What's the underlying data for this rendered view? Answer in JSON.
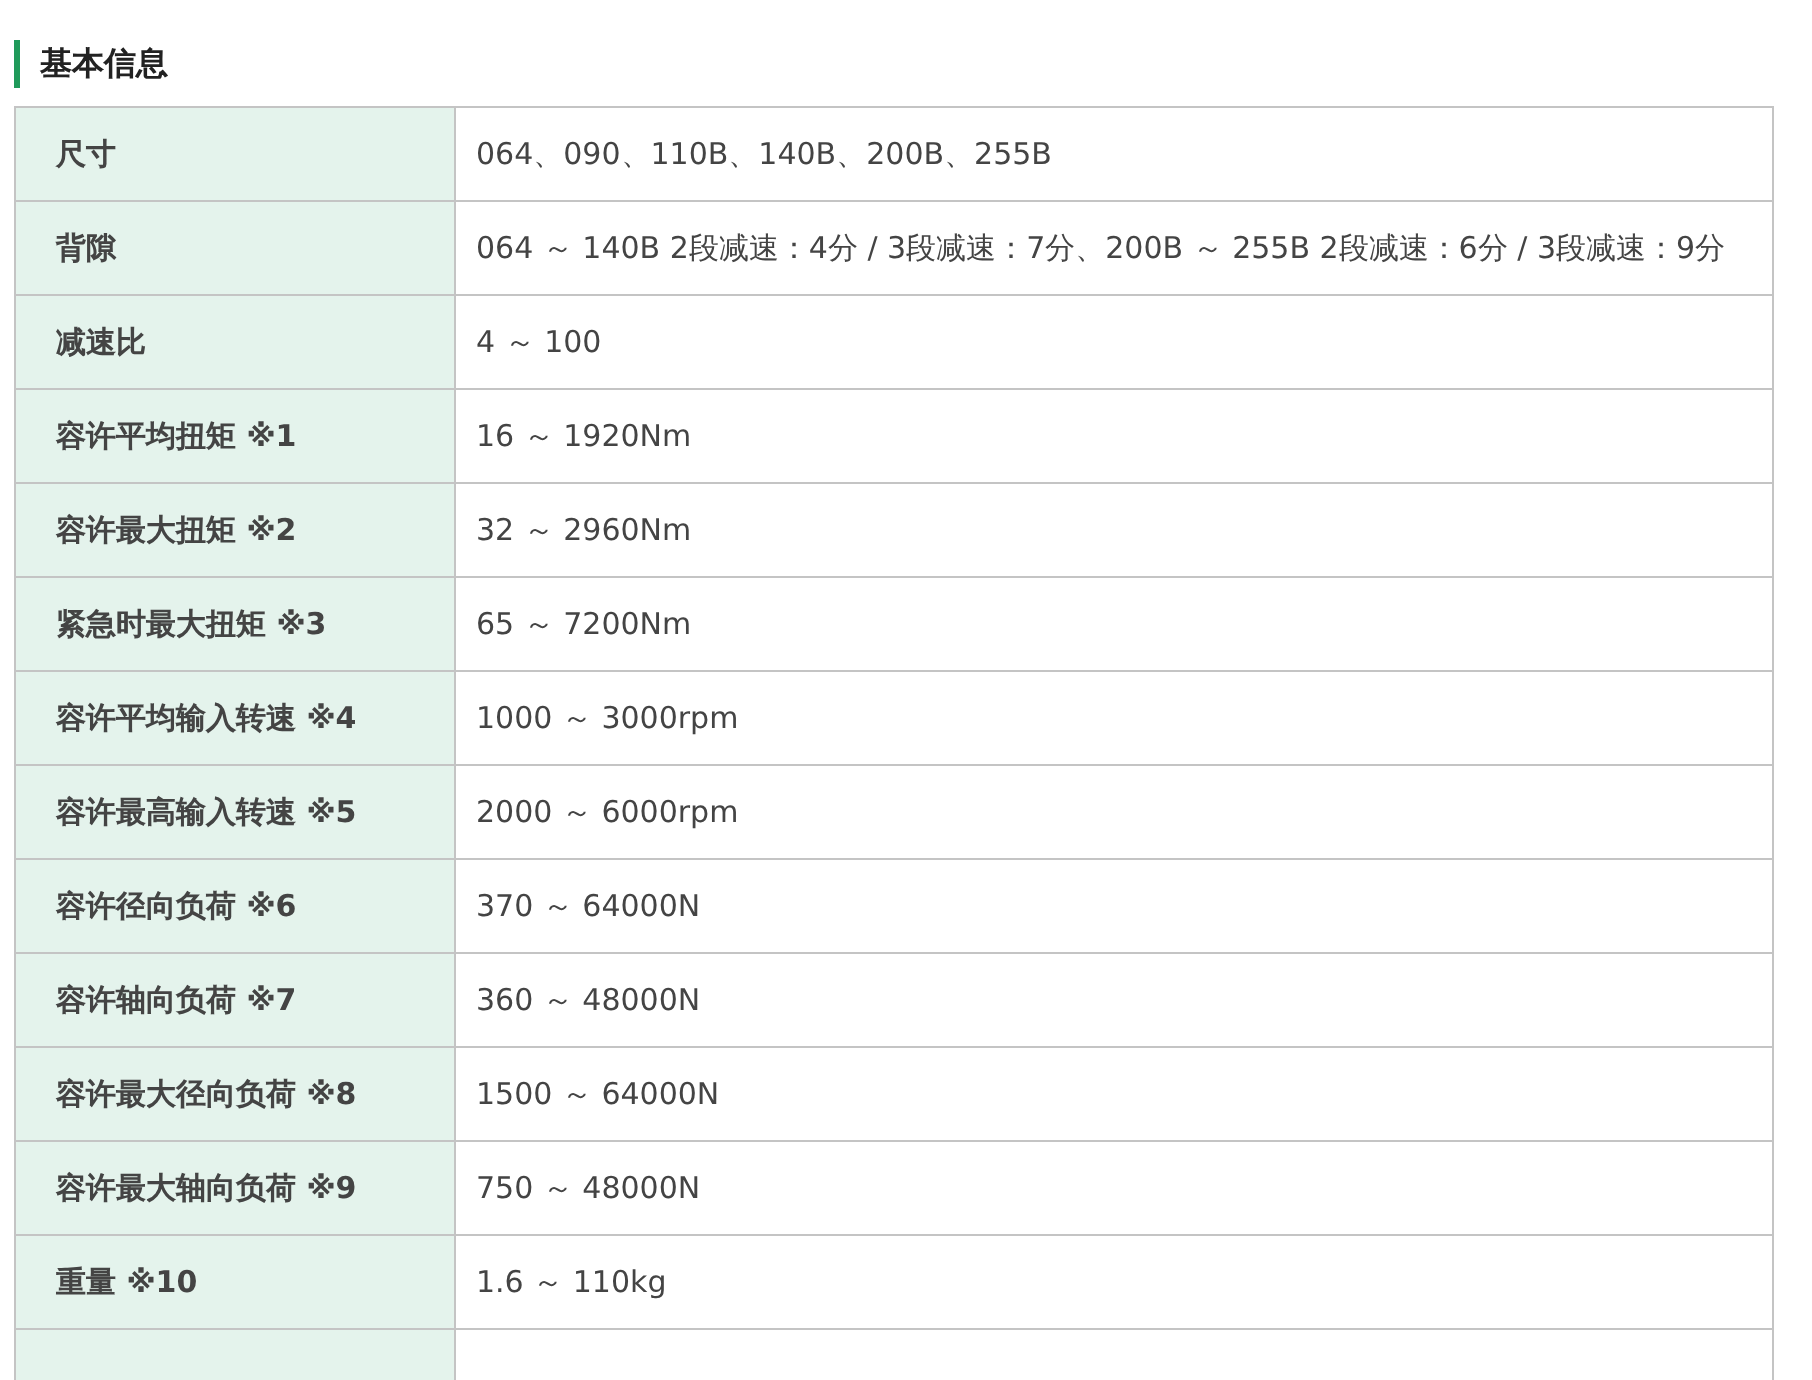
{
  "section": {
    "title": "基本信息"
  },
  "spec_table": {
    "rows": [
      {
        "label": "尺寸",
        "value": "064、090、110B、140B、200B、255B"
      },
      {
        "label": "背隙",
        "value": "064 ～ 140B 2段减速：4分 / 3段减速：7分、200B ～ 255B 2段减速：6分 / 3段减速：9分"
      },
      {
        "label": "减速比",
        "value": "4 ～ 100"
      },
      {
        "label": "容许平均扭矩 ※1",
        "value": "16 ～ 1920Nm"
      },
      {
        "label": "容许最大扭矩 ※2",
        "value": "32 ～ 2960Nm"
      },
      {
        "label": "紧急时最大扭矩 ※3",
        "value": "65 ～ 7200Nm"
      },
      {
        "label": "容许平均输入转速 ※4",
        "value": "1000 ～ 3000rpm"
      },
      {
        "label": "容许最高输入转速 ※5",
        "value": "2000 ～ 6000rpm"
      },
      {
        "label": "容许径向负荷 ※6",
        "value": "370 ～ 64000N"
      },
      {
        "label": "容许轴向负荷 ※7",
        "value": "360 ～ 48000N"
      },
      {
        "label": "容许最大径向负荷 ※8",
        "value": "1500 ～ 64000N"
      },
      {
        "label": "容许最大轴向负荷 ※9",
        "value": "750 ～ 48000N"
      },
      {
        "label": "重量 ※10",
        "value": "1.6 ～ 110kg"
      }
    ]
  }
}
